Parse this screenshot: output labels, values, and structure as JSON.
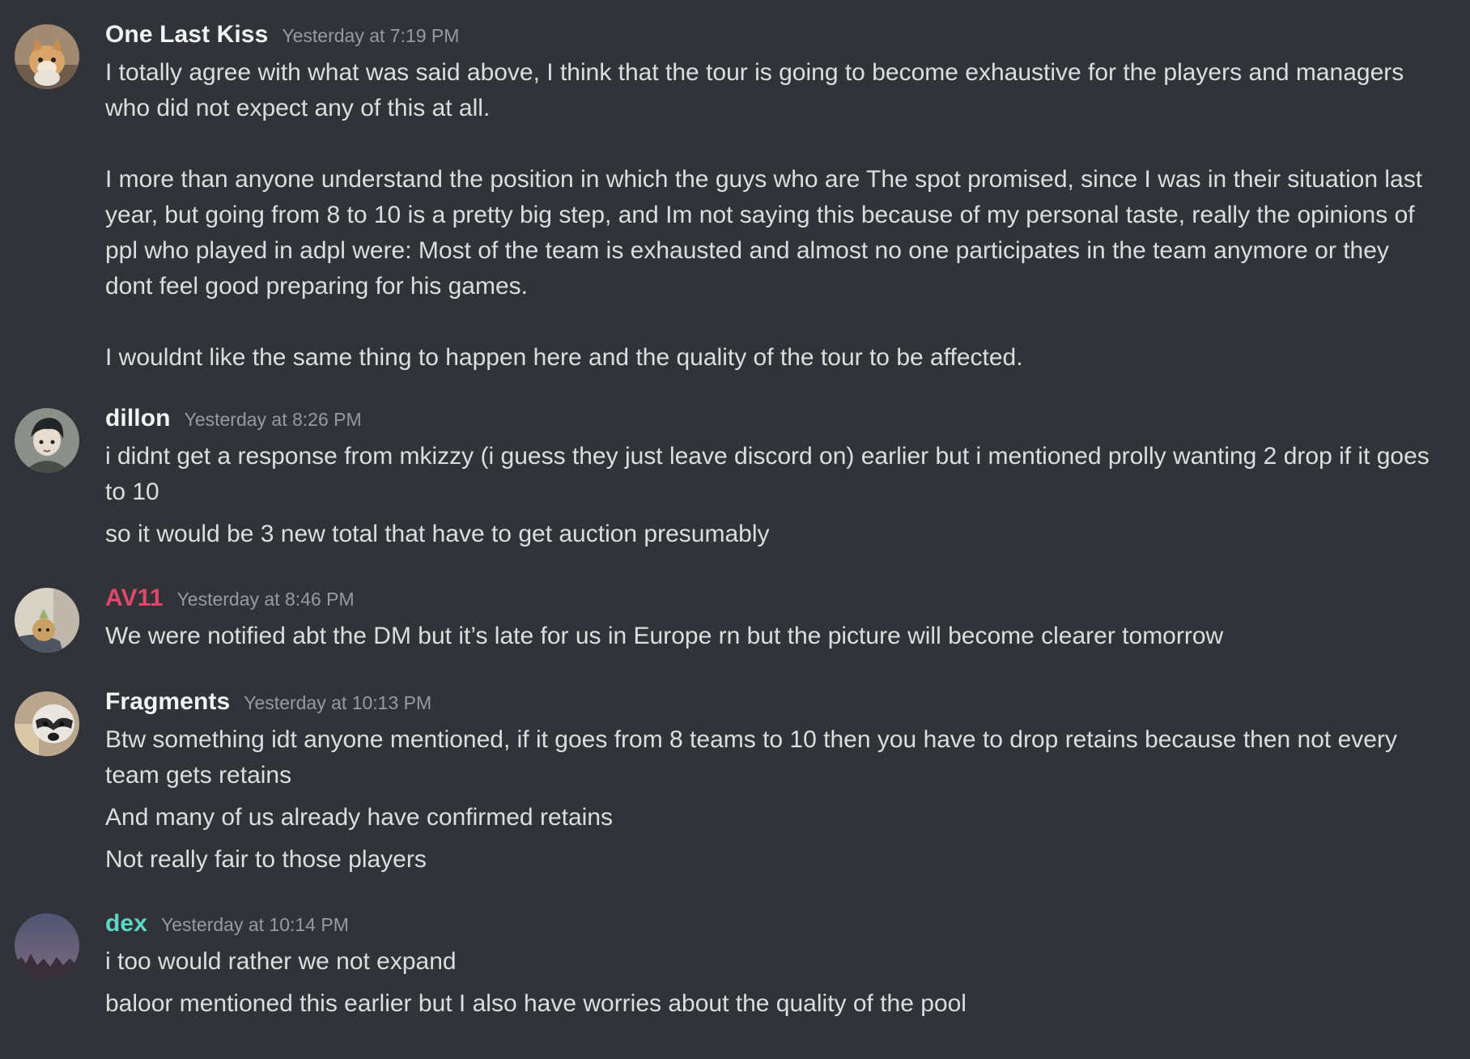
{
  "colors": {
    "background": "#313338",
    "text": "#dbdee1",
    "timestamp": "#949ba4",
    "username_default": "#f2f3f5",
    "username_av11": "#e0466b",
    "username_dex": "#5ed6c5"
  },
  "messages": [
    {
      "author": "One Last Kiss",
      "author_color": "#f2f3f5",
      "avatar_icon": "cat-avatar-icon",
      "timestamp": "Yesterday at 7:19 PM",
      "lines": [
        "I totally agree with what was said above, I think that the tour is going to become exhaustive for the players and managers who did not expect any of this at all.",
        "I more than anyone understand the position in which the guys who are The spot promised, since I was in their situation last year, but going from 8 to 10 is a pretty big step, and Im not saying this because of my personal taste, really the opinions of ppl who played in adpl were: Most of the team is exhausted and almost no one participates in the team anymore or they dont feel good preparing for his games.",
        "I wouldnt like the same thing to happen here and the quality of the tour to be affected."
      ]
    },
    {
      "author": "dillon",
      "author_color": "#f2f3f5",
      "avatar_icon": "anime-character-avatar-icon",
      "timestamp": "Yesterday at 8:26 PM",
      "lines": [
        "i didnt get a response from mkizzy (i guess they just leave discord on) earlier but i mentioned prolly wanting 2 drop if it goes to 10",
        "so it would be 3 new total that have to get auction presumably"
      ]
    },
    {
      "author": "AV11",
      "author_color": "#e0466b",
      "avatar_icon": "figurine-avatar-icon",
      "timestamp": "Yesterday at 8:46 PM",
      "lines": [
        "We were notified abt the DM but it’s late for us in Europe rn but the picture will become clearer tomorrow"
      ]
    },
    {
      "author": "Fragments",
      "author_color": "#f2f3f5",
      "avatar_icon": "raccoon-avatar-icon",
      "timestamp": "Yesterday at 10:13 PM",
      "lines": [
        "Btw something idt anyone mentioned, if it goes from 8 teams to 10 then you have to drop retains because then not every team gets retains",
        "And many of us already have confirmed retains",
        "Not really fair to those players"
      ]
    },
    {
      "author": "dex",
      "author_color": "#5ed6c5",
      "avatar_icon": "moon-avatar-icon",
      "timestamp": "Yesterday at 10:14 PM",
      "lines": [
        "i too would rather we not expand",
        "baloor mentioned this earlier but I also have worries about the quality of the pool"
      ]
    }
  ]
}
